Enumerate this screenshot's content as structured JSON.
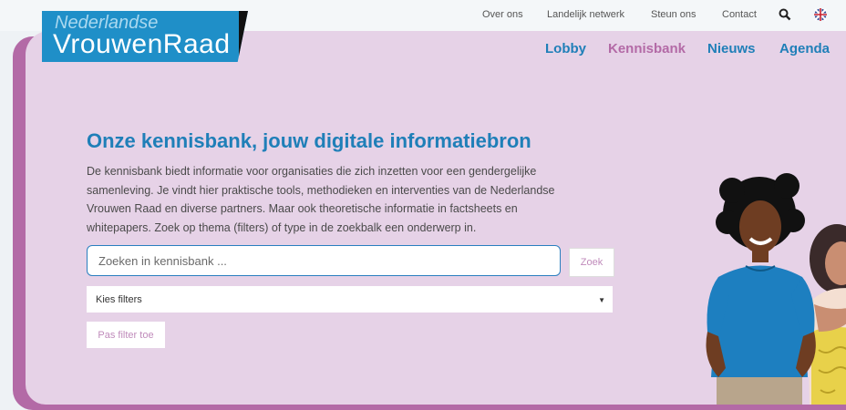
{
  "logo": {
    "line1": "Nederlandse",
    "line2": "VrouwenRaad"
  },
  "utility_nav": [
    "Over ons",
    "Landelijk netwerk",
    "Steun ons",
    "Contact"
  ],
  "main_nav": {
    "items": [
      "Lobby",
      "Kennisbank",
      "Nieuws",
      "Agenda"
    ],
    "active": "Kennisbank"
  },
  "hero": {
    "title": "Onze kennisbank, jouw digitale informatiebron",
    "intro_lines": [
      "De kennisbank biedt informatie voor organisaties die zich inzetten voor een gendergelijke",
      "samenleving. Je vindt hier praktische tools, methodieken en interventies van de Nederlandse",
      "Vrouwen Raad en diverse partners. Maar ook theoretische informatie in factsheets en",
      "whitepapers. Zoek op thema (filters) of type in de zoekbalk een onderwerp in."
    ]
  },
  "search": {
    "placeholder": "Zoeken in kennisbank ...",
    "button": "Zoek"
  },
  "filters": {
    "select_value": "Kies filters",
    "apply_button": "Pas filter toe"
  },
  "icons": {
    "search": "search-icon",
    "language": "uk-flag-icon"
  },
  "colors": {
    "brand_blue": "#1f7fb8",
    "accent_purple": "#b36aa6",
    "hero_bg": "#e6d2e7"
  }
}
